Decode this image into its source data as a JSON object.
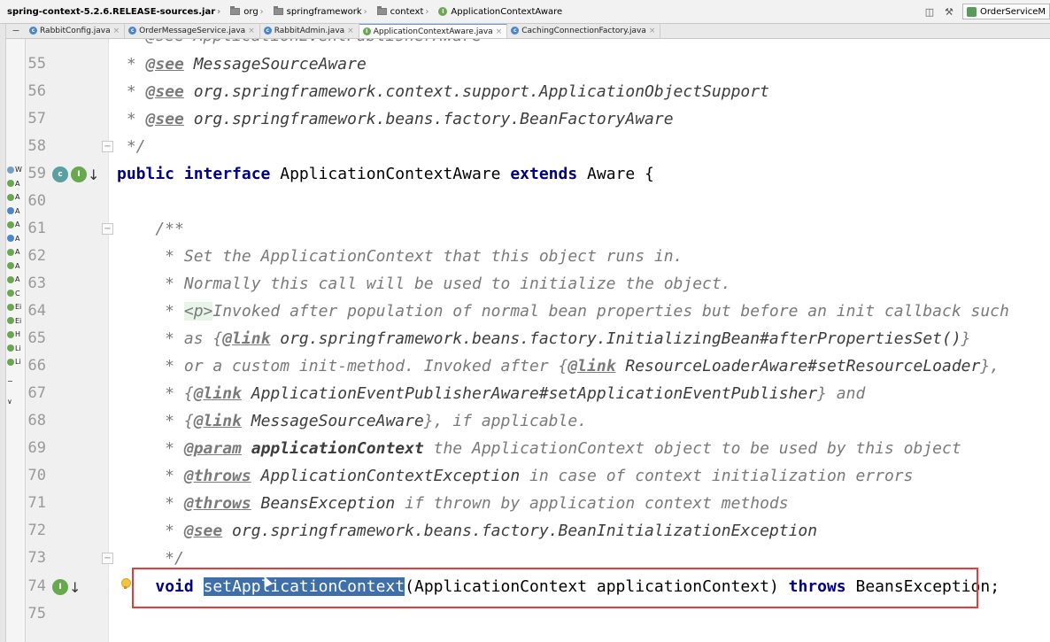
{
  "breadcrumb": {
    "jar": "spring-context-5.2.6.RELEASE-sources.jar",
    "items": [
      "org",
      "springframework",
      "context",
      "ApplicationContextAware"
    ]
  },
  "run_config": {
    "label": "OrderServiceM"
  },
  "tabs": [
    {
      "label": "RabbitConfig.java",
      "active": false
    },
    {
      "label": "OrderMessageService.java",
      "active": false
    },
    {
      "label": "RabbitAdmin.java",
      "active": false
    },
    {
      "label": "ApplicationContextAware.java",
      "active": true
    },
    {
      "label": "CachingConnectionFactory.java",
      "active": false
    }
  ],
  "tree_rows": [
    "W",
    "A",
    "A",
    "A",
    "A",
    "A",
    "A",
    "A",
    "A",
    "C",
    "Ei",
    "Ei",
    "H",
    "Li",
    "Li"
  ],
  "lines": {
    "l55": {
      "no": "55",
      "p1": " * ",
      "tag": "@see",
      "p2": " MessageSourceAware"
    },
    "l56": {
      "no": "56",
      "p1": " * ",
      "tag": "@see",
      "p2": " org.springframework.context.support.ApplicationObjectSupport"
    },
    "l57": {
      "no": "57",
      "p1": " * ",
      "tag": "@see",
      "p2": " org.springframework.beans.factory.BeanFactoryAware"
    },
    "l58": {
      "no": "58",
      "text": " */"
    },
    "l59": {
      "no": "59",
      "kw1": "public interface",
      "name": " ApplicationContextAware ",
      "kw2": "extends",
      "rest": " Aware {"
    },
    "l60": {
      "no": "60"
    },
    "l61": {
      "no": "61",
      "text": "    /**"
    },
    "l62": {
      "no": "62",
      "text": "     * Set the ApplicationContext that this object runs in."
    },
    "l63": {
      "no": "63",
      "text": "     * Normally this call will be used to initialize the object."
    },
    "l64": {
      "no": "64",
      "p1": "     * ",
      "html": "<p>",
      "p2": "Invoked after population of normal bean properties but before an init callback such"
    },
    "l65": {
      "no": "65",
      "p1": "     * as {",
      "tag": "@link",
      "val": " org.springframework.beans.factory.InitializingBean#afterPropertiesSet()",
      "p2": "}"
    },
    "l66": {
      "no": "66",
      "p1": "     * or a custom init-method. Invoked after {",
      "tag": "@link",
      "val": " ResourceLoaderAware#setResourceLoader",
      "p2": "},"
    },
    "l67": {
      "no": "67",
      "p1": "     * {",
      "tag": "@link",
      "val": " ApplicationEventPublisherAware#setApplicationEventPublisher",
      "p2": "} and"
    },
    "l68": {
      "no": "68",
      "p1": "     * {",
      "tag": "@link",
      "val": " MessageSourceAware",
      "p2": "}, if applicable."
    },
    "l69": {
      "no": "69",
      "p1": "     * ",
      "tag": "@param",
      "val": " applicationContext",
      "p2": " the ApplicationContext object to be used by this object"
    },
    "l70": {
      "no": "70",
      "p1": "     * ",
      "tag": "@throws",
      "val": " ApplicationContextException",
      "p2": " in case of context initialization errors"
    },
    "l71": {
      "no": "71",
      "p1": "     * ",
      "tag": "@throws",
      "val": " BeansException",
      "p2": " if thrown by application context methods"
    },
    "l72": {
      "no": "72",
      "p1": "     * ",
      "tag": "@see",
      "val": " org.springframework.beans.factory.BeanInitializationException"
    },
    "l73": {
      "no": "73",
      "text": "     */"
    },
    "l74": {
      "no": "74",
      "indent": "    ",
      "kw": "void",
      "sp": " ",
      "sel": "setApplicationContext",
      "rest1": "(ApplicationContext applicationContext) ",
      "kw2": "throws",
      "rest2": " BeansException;"
    },
    "l75": {
      "no": "75"
    },
    "top_partial": " * @see ApplicationEventPublisherAware"
  },
  "colors": {
    "highlight_box": "#e8393d",
    "selection": "#3f6fa8",
    "keyword": "#000080",
    "comment": "#7a7a7a"
  }
}
